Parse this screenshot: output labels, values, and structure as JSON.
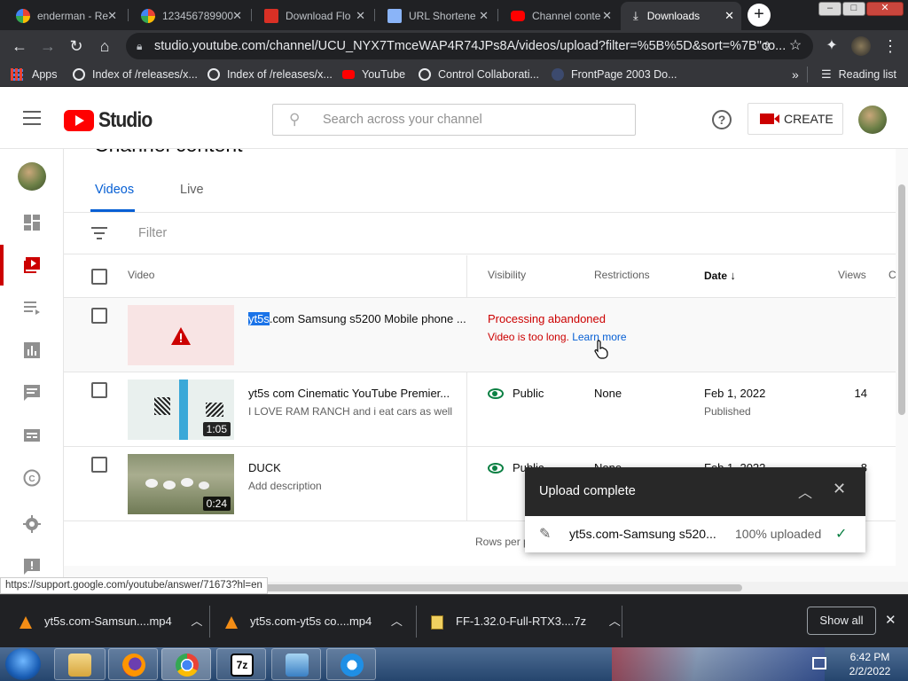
{
  "browser": {
    "tabs": [
      {
        "title": "enderman - Re",
        "favicon": "google-icon",
        "active": false
      },
      {
        "title": "123456789900",
        "favicon": "google-icon",
        "active": false
      },
      {
        "title": "Download Flo",
        "favicon": "store-icon",
        "active": false
      },
      {
        "title": "URL Shortene",
        "favicon": "link-icon",
        "active": false
      },
      {
        "title": "Channel conte",
        "favicon": "youtube-icon",
        "active": false
      },
      {
        "title": "Downloads",
        "favicon": "download-icon",
        "active": true
      }
    ],
    "url": "studio.youtube.com/channel/UCU_NYX7TmceWAP4R74JPs8A/videos/upload?filter=%5B%5D&sort=%7B\"co...",
    "bookmarks": [
      {
        "label": "Apps",
        "icon": "apps-grid-icon"
      },
      {
        "label": "Index of /releases/x...",
        "icon": "globe-icon"
      },
      {
        "label": "Index of /releases/x...",
        "icon": "globe-icon"
      },
      {
        "label": "YouTube",
        "icon": "youtube-icon"
      },
      {
        "label": "Control Collaborati...",
        "icon": "globe-icon"
      },
      {
        "label": "FrontPage 2003 Do...",
        "icon": "page-icon"
      }
    ],
    "reading_list": "Reading list",
    "status_url": "https://support.google.com/youtube/answer/71673?hl=en"
  },
  "studio": {
    "logo_text": "Studio",
    "search_placeholder": "Search across your channel",
    "create_label": "CREATE",
    "page_title": "Channel content",
    "content_tabs": [
      "Videos",
      "Live"
    ],
    "filter_placeholder": "Filter",
    "columns": {
      "video": "Video",
      "visibility": "Visibility",
      "restrictions": "Restrictions",
      "date": "Date",
      "views": "Views",
      "comments": "C"
    },
    "rows": [
      {
        "title_highlight": "yt5s",
        "title_rest": ".com Samsung s5200 Mobile phone ...",
        "status": "Processing abandoned",
        "status_detail": "Video is too long.",
        "learn_more": "Learn more"
      },
      {
        "title": "yt5s com Cinematic YouTube Premier...",
        "description": "I LOVE RAM RANCH and i eat cars as well",
        "duration": "1:05",
        "visibility": "Public",
        "restrictions": "None",
        "date": "Feb 1, 2022",
        "date_status": "Published",
        "views": "14"
      },
      {
        "title": "DUCK",
        "description": "Add description",
        "duration": "0:24",
        "visibility": "Public",
        "restrictions": "None",
        "date": "Feb 1, 2022",
        "views": "8"
      }
    ],
    "rows_per_page_label": "Rows per p",
    "upload_toast": {
      "title": "Upload complete",
      "file": "yt5s.com-Samsung s520...",
      "progress": "100% uploaded"
    }
  },
  "downloads": {
    "items": [
      {
        "name": "yt5s.com-Samsun....mp4",
        "icon": "vlc-icon"
      },
      {
        "name": "yt5s.com-yt5s co....mp4",
        "icon": "vlc-icon"
      },
      {
        "name": "FF-1.32.0-Full-RTX3....7z",
        "icon": "archive-icon"
      }
    ],
    "show_all": "Show all"
  },
  "taskbar": {
    "time": "6:42 PM",
    "date": "2/2/2022"
  },
  "colors": {
    "accent_blue": "#065fd4",
    "youtube_red": "#ff0000",
    "error_red": "#cc0000",
    "public_green": "#0b8043"
  }
}
